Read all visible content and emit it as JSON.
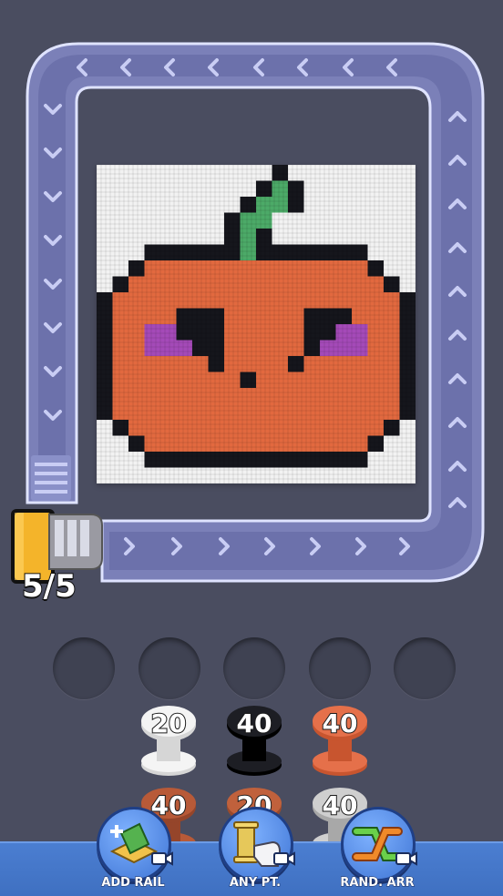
{
  "puzzle": {
    "grid_size": 20,
    "palette": {
      "W": "#f2f2f2",
      "K": "#15161c",
      "O": "#e2693f",
      "G": "#4caa68",
      "P": "#a44ab8"
    },
    "rows": [
      "WWWWWWWWWWWKWWWWWWWW",
      "WWWWWWWWWWKGKWWWWWWW",
      "WWWWWWWWWKGGKWWWWWWW",
      "WWWWWWWWKGGWWWWWWWWW",
      "WWWWWWWWKGKWWWWWWWWW",
      "WWWKKKKKKGKKKKKKKWWW",
      "WWKOOOOOOOOOOOOOOKWW",
      "WKOOOOOOOOOOOOOOOOKW",
      "KOOOOOOOOOOOOOOOOOOK",
      "KOOOOKKKOOOOOKKKOOOK",
      "KOOPPKKKOOOOOKKPPOOK",
      "KOOPPPKKOOOOOKPPPOOK",
      "KOOOOOOKOOOOKOOOOOOK",
      "KOOOOOOOOKOOOOOOOOOK",
      "KOOOOOOOOOOOOOOOOOOK",
      "KOOOOOOOOOOOOOOOOOOK",
      "WKOOOOOOOOOOOOOOOOKW",
      "WWKOOOOOOOOOOOOOOKWW",
      "WWWKKKKKKKKKKKKKKWWW",
      "WWWWWWWWWWWWWWWWWWWW"
    ]
  },
  "cart": {
    "count_label": "5/5",
    "color": "#f4b42a"
  },
  "slots": [
    {
      "state": "empty"
    },
    {
      "state": "empty"
    },
    {
      "state": "empty"
    },
    {
      "state": "empty"
    },
    {
      "state": "empty"
    }
  ],
  "spools": [
    {
      "count": "20",
      "color": "#f4f4f4",
      "rim": "#d6d6d6"
    },
    {
      "count": "40",
      "color": "#1d1e24",
      "rim": "#000000"
    },
    {
      "count": "40",
      "color": "#e5704a",
      "rim": "#c8552f"
    },
    {
      "count": "40",
      "color": "#b85a38",
      "rim": "#95452a"
    },
    {
      "count": "20",
      "color": "#c0613c",
      "rim": "#9a4a2c"
    },
    {
      "count": "40",
      "color": "#cfcfcf",
      "rim": "#a8a8a8"
    }
  ],
  "tools": [
    {
      "label": "ADD RAIL",
      "icon": "add-rail-icon"
    },
    {
      "label": "ANY PT.",
      "icon": "any-point-icon"
    },
    {
      "label": "RAND. ARR",
      "icon": "random-arrange-icon"
    }
  ]
}
